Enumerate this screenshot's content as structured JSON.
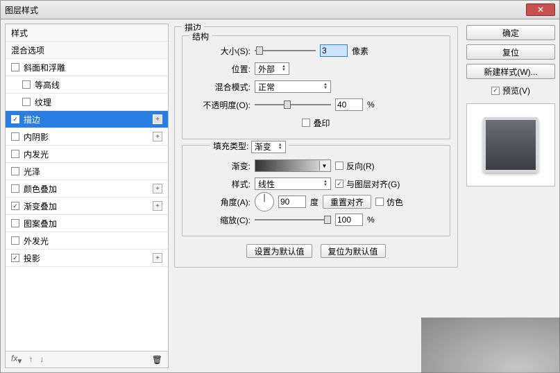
{
  "window": {
    "title": "图层样式"
  },
  "left": {
    "header_styles": "样式",
    "header_blend": "混合选项",
    "items": [
      {
        "label": "斜面和浮雕",
        "checked": false,
        "indent": false,
        "expand": false
      },
      {
        "label": "等高线",
        "checked": false,
        "indent": true,
        "expand": false
      },
      {
        "label": "纹理",
        "checked": false,
        "indent": true,
        "expand": false
      },
      {
        "label": "描边",
        "checked": true,
        "indent": false,
        "expand": true,
        "selected": true
      },
      {
        "label": "内阴影",
        "checked": false,
        "indent": false,
        "expand": true
      },
      {
        "label": "内发光",
        "checked": false,
        "indent": false,
        "expand": false
      },
      {
        "label": "光泽",
        "checked": false,
        "indent": false,
        "expand": false
      },
      {
        "label": "颜色叠加",
        "checked": false,
        "indent": false,
        "expand": true
      },
      {
        "label": "渐变叠加",
        "checked": true,
        "indent": false,
        "expand": true
      },
      {
        "label": "图案叠加",
        "checked": false,
        "indent": false,
        "expand": false
      },
      {
        "label": "外发光",
        "checked": false,
        "indent": false,
        "expand": false
      },
      {
        "label": "投影",
        "checked": true,
        "indent": false,
        "expand": true
      }
    ],
    "footer_fx": "fx"
  },
  "center": {
    "group_title": "描边",
    "struct_title": "结构",
    "size_label": "大小(S):",
    "size_value": "3",
    "size_unit": "像素",
    "position_label": "位置:",
    "position_value": "外部",
    "blend_label": "混合模式:",
    "blend_value": "正常",
    "opacity_label": "不透明度(O):",
    "opacity_value": "40",
    "opacity_unit": "%",
    "overprint_label": "叠印",
    "fill_type_label": "填充类型:",
    "fill_type_value": "渐变",
    "gradient_label": "渐变:",
    "reverse_label": "反向(R)",
    "style_label": "样式:",
    "style_value": "线性",
    "align_label": "与图层对齐(G)",
    "angle_label": "角度(A):",
    "angle_value": "90",
    "angle_unit": "度",
    "reset_align": "重置对齐",
    "dither_label": "仿色",
    "scale_label": "缩放(C):",
    "scale_value": "100",
    "scale_unit": "%",
    "make_default": "设置为默认值",
    "reset_default": "复位为默认值"
  },
  "right": {
    "ok": "确定",
    "reset": "复位",
    "new_style": "新建样式(W)...",
    "preview_label": "预览(V)"
  }
}
